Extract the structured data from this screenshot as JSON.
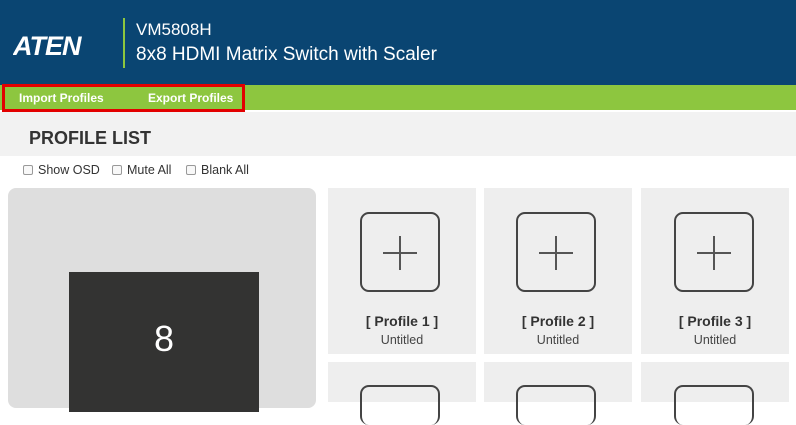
{
  "header": {
    "logo_text": "ATEN",
    "model": "VM5808H",
    "product": "8x8 HDMI Matrix Switch with Scaler"
  },
  "menu": {
    "items": [
      {
        "label": "Import Profiles"
      },
      {
        "label": "Export Profiles"
      }
    ]
  },
  "section": {
    "title": "PROFILE LIST"
  },
  "options": [
    {
      "label": "Show OSD",
      "checked": false
    },
    {
      "label": "Mute All",
      "checked": false
    },
    {
      "label": "Blank All",
      "checked": false
    }
  ],
  "preview": {
    "screen_number": "8"
  },
  "profiles": [
    {
      "name": "[ Profile 1 ]",
      "subtitle": "Untitled"
    },
    {
      "name": "[ Profile 2 ]",
      "subtitle": "Untitled"
    },
    {
      "name": "[ Profile 3 ]",
      "subtitle": "Untitled"
    }
  ],
  "colors": {
    "header_bg": "#0a4572",
    "menu_bg": "#8dc63f",
    "highlight": "#e30000"
  }
}
